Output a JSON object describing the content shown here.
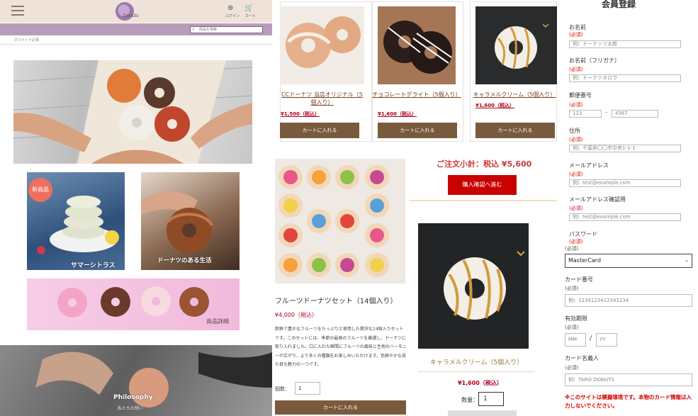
{
  "panel1": {
    "header": {
      "logo_text": "Donuts",
      "login_label": "ログイン",
      "cart_label": "カート"
    },
    "search": {
      "placeholder": "商品を検索"
    },
    "breadcrumb": "ホワイトイ記事",
    "tiles": {
      "new_badge": "新商品",
      "summer_citrus": "サマーシトラス",
      "donut_life": "ドーナツのある生活",
      "product_detail": "商品詳細",
      "philosophy_title": "Philosophy",
      "philosophy_sub": "私たちの想い"
    }
  },
  "panel2": {
    "products": [
      {
        "name": "CCドーナツ 当店オリジナル（5個入り）",
        "price": "¥1,500（税込）",
        "cart": "カートに入れる"
      },
      {
        "name": "チョコレートデライト（5個入り）",
        "price": "¥1,600（税込）",
        "cart": "カートに入れる"
      },
      {
        "name": "キャラメルクリーム（5個入り）",
        "price": "¥1,600（税込）",
        "cart": "カートに入れる"
      }
    ],
    "fruit": {
      "title": "フルーツドーナツセット（14個入り）",
      "price": "¥4,000（税込）",
      "desc": "新鮮で豊かなフルーツをたっぷりと使用した贅沢な14個入りセットです。このセットには、季節の最高のフルーツを厳選し、ドーナツに取り入れました。口に入れた瞬間にフルーツの風味と生地のハーモニーが広がり、より多くの種類をお楽しみいただけます。色鮮やかな見た目も魅力の一つです。",
      "qty_label": "個数：",
      "qty_value": "1",
      "cart": "カートに入れる"
    },
    "subtotal": {
      "label": "ご注文小計：税込 ¥5,600",
      "confirm": "購入確認へ進む"
    },
    "caramel": {
      "title": "キャラメルクリーム（5個入り）",
      "price": "¥1,600（税込）",
      "qty_label": "数量：",
      "qty_value": "1"
    }
  },
  "panel3": {
    "title": "会員登録",
    "fields": {
      "name": {
        "label": "お名前",
        "req": "(必須)",
        "placeholder": "例）ドーナッツ太郎"
      },
      "kana": {
        "label": "お名前（フリガナ）",
        "req": "(必須)",
        "placeholder": "例）ドーナツタロウ"
      },
      "zip": {
        "label": "郵便番号",
        "req": "(必須)",
        "zip1": "123",
        "dash": "-",
        "zip2": "4567"
      },
      "address": {
        "label": "住所",
        "req": "(必須)",
        "placeholder": "例）千葉県〇〇市中央1-1-1"
      },
      "email": {
        "label": "メールアドレス",
        "req": "(必須)",
        "placeholder": "例）test@example.com"
      },
      "email2": {
        "label": "メールアドレス確認用",
        "req": "(必須)",
        "placeholder": "例）test@example.com"
      },
      "password": {
        "label": "パスワード",
        "req": "(必須)"
      }
    },
    "payment": {
      "req": "(必須)",
      "brand": "MasterCard",
      "card_label": "カード番号",
      "card_req": "(必須)",
      "card_ph": "例）1234123412341234",
      "exp_label": "有効期限",
      "exp_req": "(必須)",
      "mm": "MM",
      "slash": "/",
      "yy": "YY",
      "holder_label": "カード名義人",
      "holder_req": "(必須)",
      "holder_ph": "例）TARO DONUTS",
      "warning": "※このサイトは模擬環境です。本物のカード情報は入力しないでください。"
    }
  }
}
